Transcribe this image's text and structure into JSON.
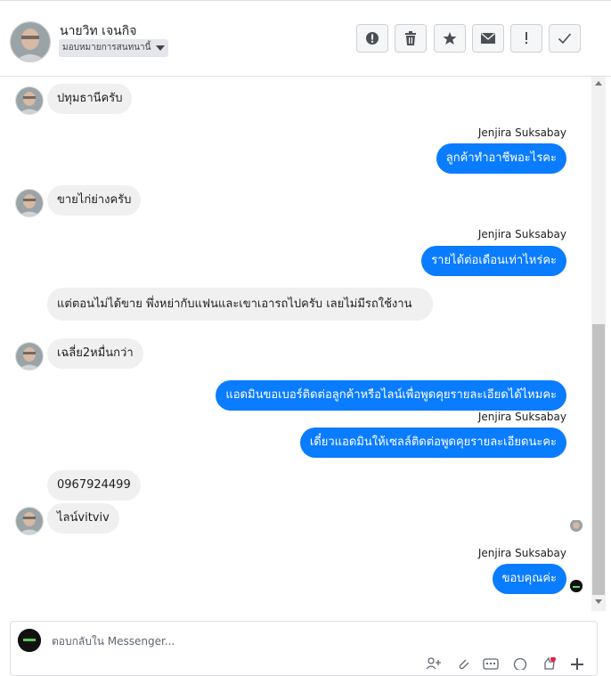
{
  "header": {
    "contact_name": "นายวิท เจนกิจ",
    "assign_label": "มอบหมายการสนทนานี้",
    "toolbar": [
      {
        "name": "spam-button",
        "icon": "alert-circle-icon"
      },
      {
        "name": "delete-button",
        "icon": "trash-icon"
      },
      {
        "name": "star-button",
        "icon": "star-icon"
      },
      {
        "name": "unread-button",
        "icon": "envelope-icon"
      },
      {
        "name": "follow-up-button",
        "icon": "exclamation-icon"
      },
      {
        "name": "mark-done-button",
        "icon": "check-icon"
      }
    ]
  },
  "messages": {
    "m1": "ปทุมธานีครับ",
    "s1": "Jenjira Suksabay",
    "m2": "ลูกค้าทำอาชีพอะไรคะ",
    "m3": "ขายไก่ย่างครับ",
    "s2": "Jenjira Suksabay",
    "m4": "รายได้ต่อเดือนเท่าไหร่คะ",
    "m5": "แต่ตอนไม่ได้ขาย พึ่งหย่ากับแฟนและเขาเอารถไปครับ เลยไม่มีรถใช้งาน",
    "m6": "เฉลี่ย2หมื่นกว่า",
    "m7": "แอดมินขอเบอร์ติดต่อลูกค้าหรือไลน์เพื่อพูดคุยรายละเอียดได้ไหมคะ",
    "s3": "Jenjira Suksabay",
    "m8": "เดี๋ยวแอดมินให้เซลล์ติดต่อพูดคุยรายละเอียดนะคะ",
    "m9": "0967924499",
    "m10": "ไลน์vitviv",
    "s4": "Jenjira Suksabay",
    "m11": "ขอบคุณค่ะ"
  },
  "composer": {
    "placeholder": "ตอบกลับใน Messenger..."
  },
  "colors": {
    "outgoing_bubble": "#0a7cff",
    "incoming_bubble": "#f0f0f0"
  }
}
